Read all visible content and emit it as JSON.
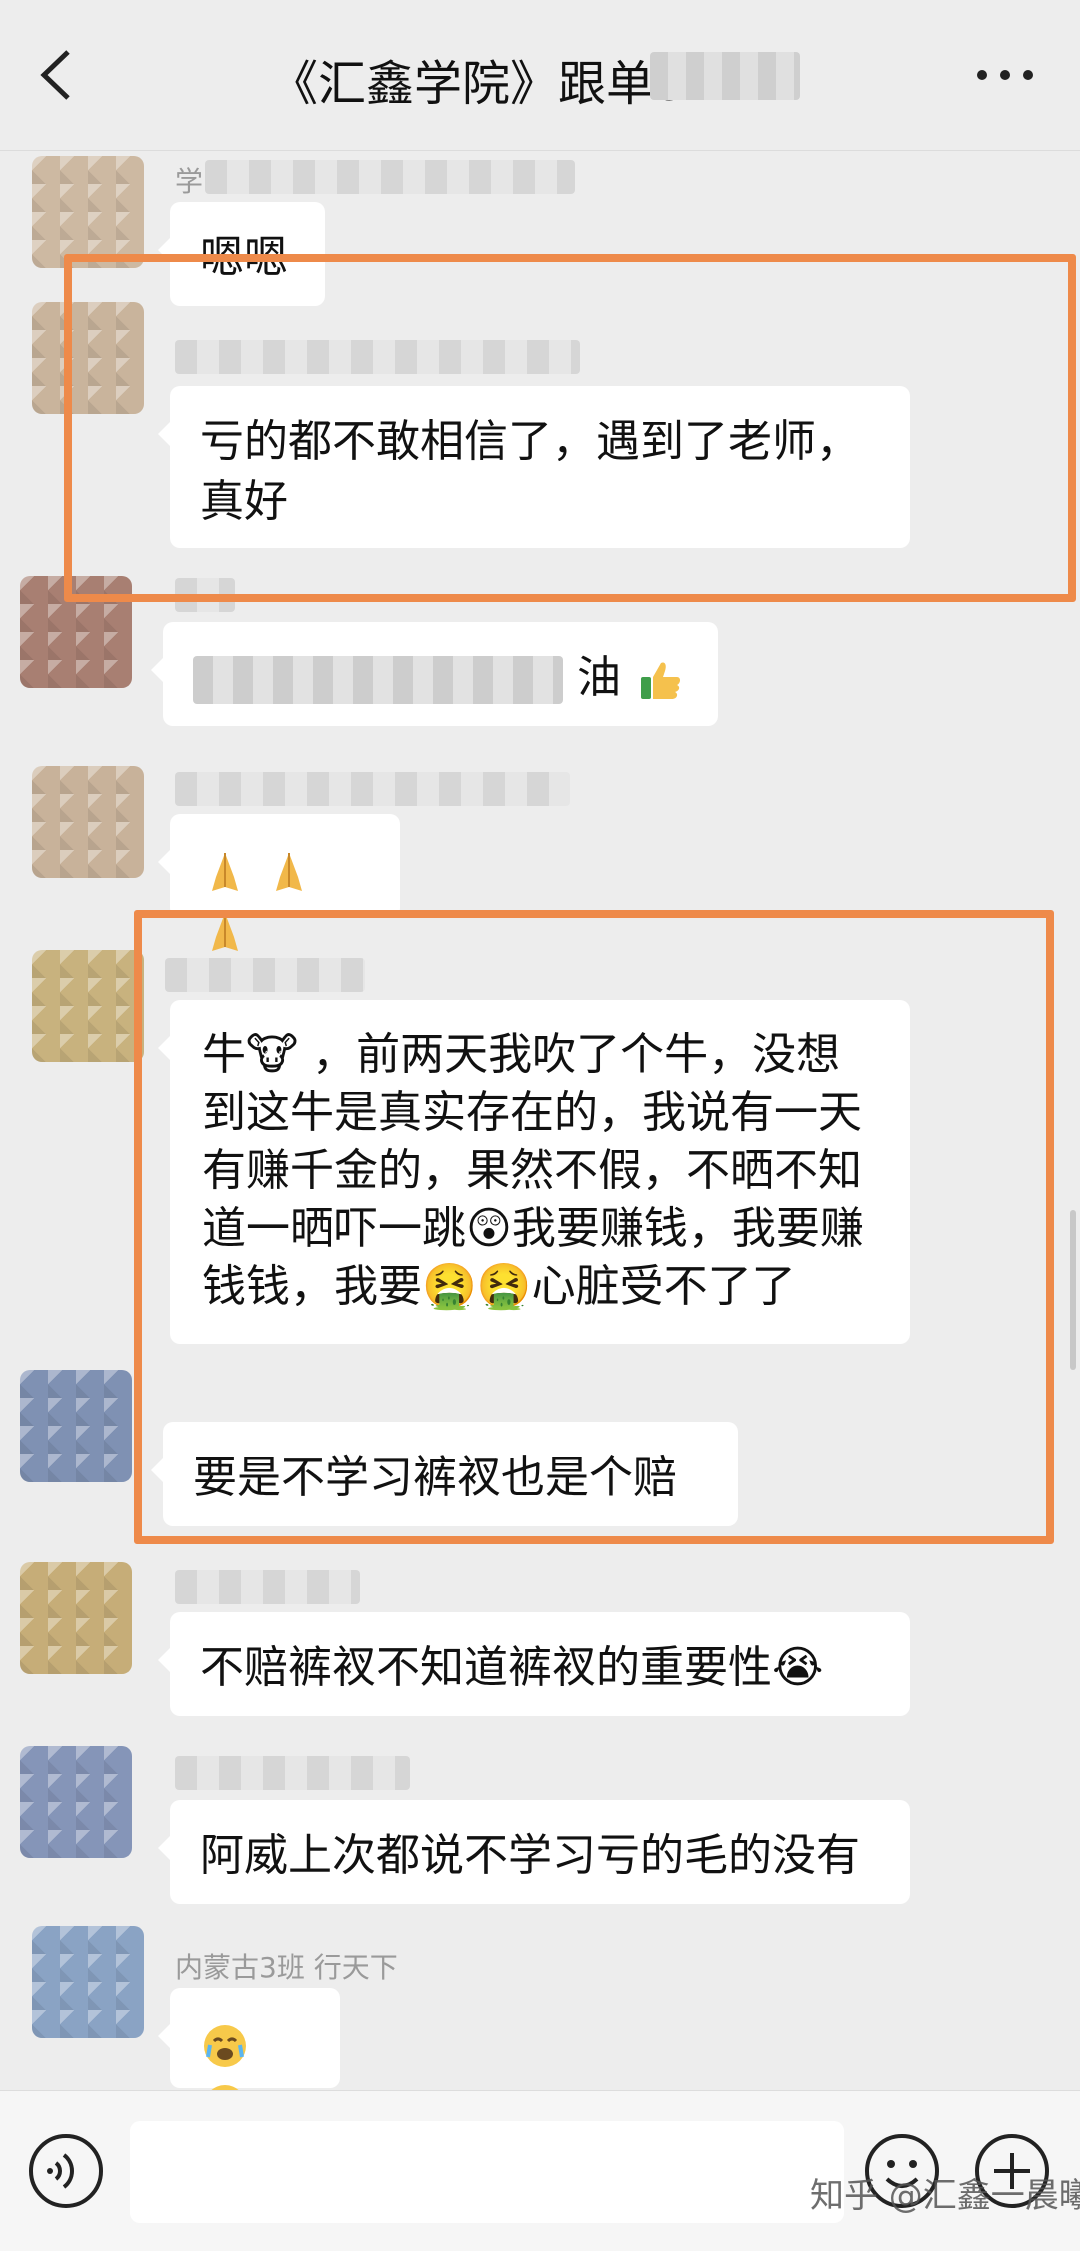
{
  "header": {
    "title": "《汇鑫学院》跟单8",
    "back_icon": "back-arrow-icon",
    "more_icon": "more-dots-icon"
  },
  "messages": [
    {
      "sender": "学",
      "text": "嗯嗯",
      "avatar_color": "#cdb9a2"
    },
    {
      "sender": "",
      "text": "亏的都不敢相信了，遇到了老师，真好",
      "avatar_color": "#c9b49c"
    },
    {
      "sender": "",
      "text_start": "",
      "text_end": "油",
      "emoji": "thumbs-up-icon",
      "avatar_color": "#a87f72"
    },
    {
      "sender": "",
      "text": "",
      "emoji": "folded-hands-icon",
      "avatar_color": "#c8b29a"
    },
    {
      "sender": "",
      "text": "牛🐮，前两天我吹了个牛，没想到这牛是真实存在的，我说有一天有赚千金的，果然不假，不晒不知道一晒吓一跳😲我要赚钱，我要赚钱钱，我要🤮🤮心脏受不了了",
      "avatar_color": "#c8b27e"
    },
    {
      "sender": "",
      "text": "要是不学习裤衩也是个赔",
      "avatar_color": "#7f91b3"
    },
    {
      "sender": "",
      "text": "不赔裤衩不知道裤衩的重要性😭",
      "avatar_color": "#c6ad78"
    },
    {
      "sender": "",
      "text": "阿威上次都说不学习亏的毛的没有",
      "avatar_color": "#8595b8"
    },
    {
      "sender": "内蒙古3班 行天下",
      "text": "",
      "emoji": "face-with-tears-icon",
      "avatar_color": "#8aa3c4"
    }
  ],
  "msg5_lines": [
    "牛🐮 ，前两天我吹了个牛，没想",
    "到这牛是真实存在的，我说有一天",
    "有赚千金的，果然不假，不晒不知",
    "道一晒吓一跳😲我要赚钱，我要赚",
    "钱钱，我要🤮🤮心脏受不了了"
  ],
  "msg2_lines": [
    "亏的都不敢相信了，遇到了老师，",
    "真好"
  ],
  "highlight_color": "#ee8a4a",
  "input_bar": {
    "voice_icon": "voice-icon",
    "emoji_icon": "smiley-icon",
    "plus_icon": "plus-icon"
  },
  "watermark": "知乎 @汇鑫一晨曦"
}
